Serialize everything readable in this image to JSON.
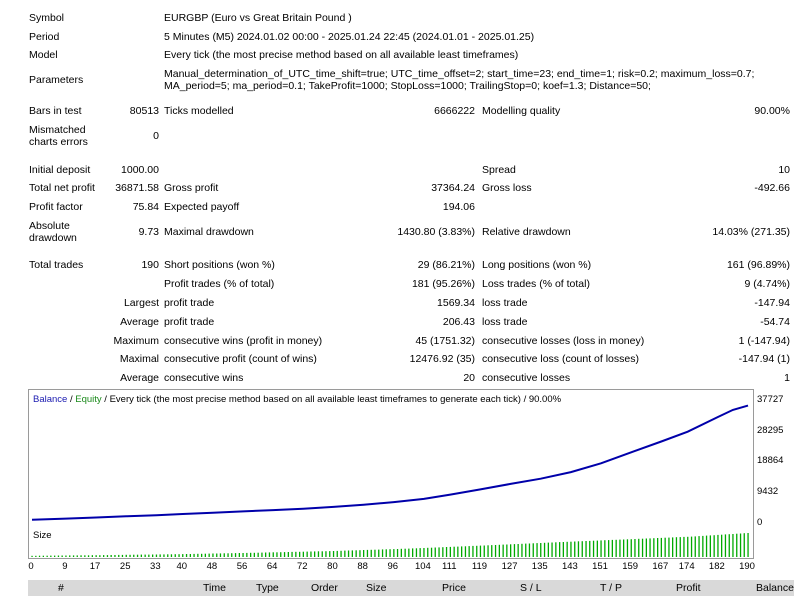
{
  "report": {
    "symbol_label": "Symbol",
    "symbol": "EURGBP (Euro vs Great Britain Pound )",
    "period_label": "Period",
    "period": "5 Minutes (M5) 2024.01.02 00:00 - 2025.01.24 22:45 (2024.01.01 - 2025.01.25)",
    "model_label": "Model",
    "model": "Every tick (the most precise method based on all available least timeframes)",
    "parameters_label": "Parameters",
    "parameters_line1": "Manual_determination_of_UTC_time_shift=true; UTC_time_offset=2; start_time=23; end_time=1; risk=0.2; maximum_loss=0.7;",
    "parameters_line2": "MA_period=5; ma_period=0.1; TakeProfit=1000; StopLoss=1000; TrailingStop=0; koef=1.3; Distance=50;",
    "bars_label": "Bars in test",
    "bars": "80513",
    "ticks_label": "Ticks modelled",
    "ticks": "6666222",
    "quality_label": "Modelling quality",
    "quality": "90.00%",
    "mismatch_label1": "Mismatched",
    "mismatch_label2": "charts errors",
    "mismatch": "0",
    "deposit_label": "Initial deposit",
    "deposit": "1000.00",
    "spread_label": "Spread",
    "spread": "10",
    "net_profit_label": "Total net profit",
    "net_profit": "36871.58",
    "gross_profit_label": "Gross profit",
    "gross_profit": "37364.24",
    "gross_loss_label": "Gross loss",
    "gross_loss": "-492.66",
    "profit_factor_label": "Profit factor",
    "profit_factor": "75.84",
    "expected_payoff_label": "Expected payoff",
    "expected_payoff": "194.06",
    "abs_dd_label1": "Absolute",
    "abs_dd_label2": "drawdown",
    "abs_dd": "9.73",
    "max_dd_label": "Maximal drawdown",
    "max_dd": "1430.80 (3.83%)",
    "rel_dd_label": "Relative drawdown",
    "rel_dd": "14.03% (271.35)",
    "total_trades_label": "Total trades",
    "total_trades": "190",
    "short_label": "Short positions (won %)",
    "short": "29 (86.21%)",
    "long_label": "Long positions (won %)",
    "long": "161 (96.89%)",
    "profit_trades_label": "Profit trades (% of total)",
    "profit_trades": "181 (95.26%)",
    "loss_trades_label": "Loss trades (% of total)",
    "loss_trades": "9 (4.74%)",
    "largest_label": "Largest",
    "largest_profit_label": "profit trade",
    "largest_profit": "1569.34",
    "largest_loss_label": "loss trade",
    "largest_loss": "-147.94",
    "average_label": "Average",
    "average_profit_label": "profit trade",
    "average_profit": "206.43",
    "average_loss_label": "loss trade",
    "average_loss": "-54.74",
    "maximum_label": "Maximum",
    "max_cons_wins_label": "consecutive wins (profit in money)",
    "max_cons_wins": "45 (1751.32)",
    "max_cons_losses_label": "consecutive losses (loss in money)",
    "max_cons_losses": "1 (-147.94)",
    "maximal_label": "Maximal",
    "maximal_cons_profit_label": "consecutive profit (count of wins)",
    "maximal_cons_profit": "12476.92 (35)",
    "maximal_cons_loss_label": "consecutive loss (count of losses)",
    "maximal_cons_loss": "-147.94 (1)",
    "avg_label2": "Average",
    "avg_cons_wins_label": "consecutive wins",
    "avg_cons_wins": "20",
    "avg_cons_losses_label": "consecutive losses",
    "avg_cons_losses": "1"
  },
  "chart": {
    "legend_balance": "Balance",
    "legend_sep1": " / ",
    "legend_equity": "Equity",
    "legend_sep2": " / ",
    "legend_rest": "Every tick (the most precise method based on all available least timeframes to generate each tick) / 90.00%",
    "size_label": "Size",
    "colors": {
      "balance": "#0000aa",
      "equity": "#008800",
      "size_bars": "#00aa00",
      "legend_balance": "#1a1ab0",
      "legend_equity": "#1a8a1a"
    }
  },
  "chart_data": {
    "type": "line",
    "y_ticks": [
      "37727",
      "28295",
      "18864",
      "9432",
      "0"
    ],
    "ylim": [
      0,
      37727
    ],
    "x_ticks": [
      "0",
      "9",
      "17",
      "25",
      "33",
      "40",
      "48",
      "56",
      "64",
      "72",
      "80",
      "88",
      "96",
      "104",
      "111",
      "119",
      "127",
      "135",
      "143",
      "151",
      "159",
      "167",
      "174",
      "182",
      "190"
    ],
    "xlim": [
      0,
      190
    ],
    "series": [
      {
        "name": "Balance",
        "x": [
          0,
          9,
          17,
          25,
          33,
          40,
          48,
          56,
          64,
          72,
          80,
          88,
          96,
          104,
          111,
          119,
          127,
          135,
          143,
          151,
          159,
          167,
          174,
          182,
          186,
          190
        ],
        "values": [
          1000,
          1350,
          1700,
          2050,
          2400,
          2750,
          3150,
          3550,
          3950,
          4400,
          4950,
          5600,
          6400,
          7400,
          8700,
          10300,
          12000,
          13600,
          15600,
          18300,
          21700,
          25000,
          28000,
          32500,
          34700,
          36000
        ]
      },
      {
        "name": "Equity",
        "x": [
          0,
          9,
          17,
          25,
          33,
          40,
          48,
          56,
          64,
          72,
          80,
          88,
          96,
          104,
          111,
          119,
          127,
          135,
          143,
          151,
          159,
          167,
          174,
          182,
          186,
          190
        ],
        "values": [
          990,
          1340,
          1690,
          2040,
          2390,
          2740,
          3140,
          3540,
          3940,
          4390,
          4940,
          5590,
          6390,
          7390,
          8690,
          10290,
          11990,
          13590,
          15590,
          18290,
          21690,
          24990,
          27990,
          32490,
          34690,
          35990
        ]
      }
    ],
    "size_series": {
      "name": "Size",
      "x": [
        0,
        20,
        40,
        60,
        80,
        100,
        120,
        140,
        160,
        175,
        190
      ],
      "values": [
        0.5,
        0.8,
        1.2,
        1.8,
        2.5,
        3.5,
        4.8,
        6.2,
        7.5,
        8.5,
        10
      ]
    }
  },
  "table_header": {
    "num": "#",
    "time": "Time",
    "type": "Type",
    "order": "Order",
    "size": "Size",
    "price": "Price",
    "sl": "S / L",
    "tp": "T / P",
    "profit": "Profit",
    "balance": "Balance"
  }
}
